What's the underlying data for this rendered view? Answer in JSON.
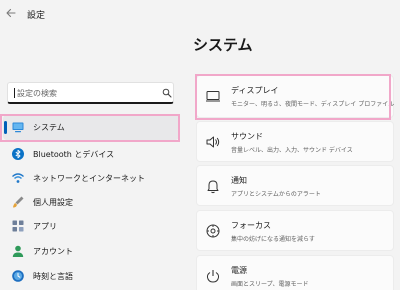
{
  "window": {
    "title": "設定"
  },
  "search": {
    "placeholder": "設定の検索",
    "value": ""
  },
  "sidebar": {
    "items": [
      {
        "label": "システム",
        "icon": "monitor-icon",
        "selected": true
      },
      {
        "label": "Bluetooth とデバイス",
        "icon": "bluetooth-icon"
      },
      {
        "label": "ネットワークとインターネット",
        "icon": "wifi-icon"
      },
      {
        "label": "個人用設定",
        "icon": "brush-icon"
      },
      {
        "label": "アプリ",
        "icon": "apps-icon"
      },
      {
        "label": "アカウント",
        "icon": "person-icon"
      },
      {
        "label": "時刻と言語",
        "icon": "globe-clock-icon"
      }
    ]
  },
  "main": {
    "title": "システム",
    "cards": [
      {
        "title": "ディスプレイ",
        "subtitle": "モニター、明るさ、夜間モード、ディスプレイ プロファイル",
        "icon": "display-icon"
      },
      {
        "title": "サウンド",
        "subtitle": "音量レベル、出力、入力、サウンド デバイス",
        "icon": "speaker-icon"
      },
      {
        "title": "通知",
        "subtitle": "アプリとシステムからのアラート",
        "icon": "bell-icon"
      },
      {
        "title": "フォーカス",
        "subtitle": "集中の妨げになる通知を減らす",
        "icon": "focus-icon"
      },
      {
        "title": "電源",
        "subtitle": "画面とスリープ、電源モード",
        "icon": "power-icon"
      }
    ]
  },
  "colors": {
    "accent": "#005fb8",
    "highlight": "#f1a7c9",
    "background": "#f3f3f3"
  }
}
